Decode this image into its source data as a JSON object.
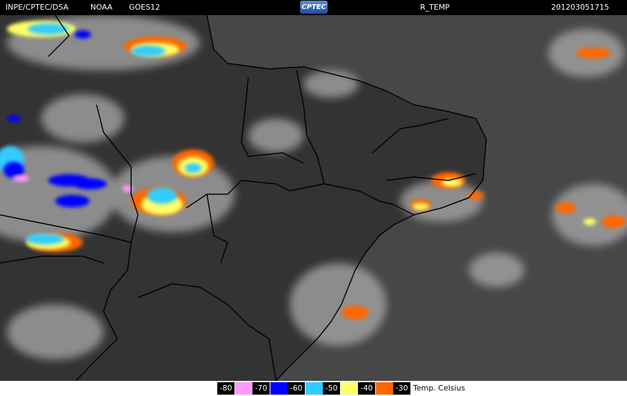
{
  "header": {
    "agency": "INPE/CPTEC/DSA",
    "source": "NOAA",
    "satellite": "GOES12",
    "logo": "CPTEC",
    "product": "R_TEMP",
    "timestamp": "201203051715"
  },
  "legend": {
    "unit_label": "Temp. Celsius",
    "items": [
      {
        "value": "-80",
        "color": "#ff99ff"
      },
      {
        "value": "-70",
        "color": "#0000ff"
      },
      {
        "value": "-60",
        "color": "#33ccff"
      },
      {
        "value": "-50",
        "color": "#ffff66"
      },
      {
        "value": "-40",
        "color": "#ff6600"
      },
      {
        "value": "-30",
        "color": ""
      }
    ]
  },
  "colors": {
    "ocean": "#474747",
    "land": "#333333",
    "cloud": "#b5b5b5",
    "border": "#000000"
  }
}
